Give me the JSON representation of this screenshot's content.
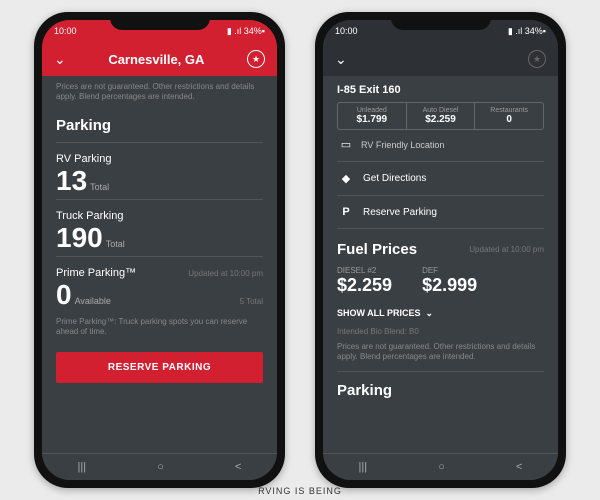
{
  "status": {
    "time": "10:00",
    "battery": "34%"
  },
  "left": {
    "title": "Carnesville, GA",
    "disclaimer": "Prices are not guaranteed. Other restrictions and details apply. Blend percentages are intended.",
    "section": "Parking",
    "rv_label": "RV Parking",
    "rv_count": "13",
    "total": "Total",
    "truck_label": "Truck Parking",
    "truck_count": "190",
    "prime_label": "Prime Parking™",
    "prime_updated": "Updated at 10:00 pm",
    "prime_count": "0",
    "available": "Available",
    "prime_total": "5 Total",
    "prime_desc": "Prime Parking™: Truck parking spots you can reserve ahead of time.",
    "reserve_btn": "RESERVE PARKING"
  },
  "right": {
    "exit": "I-85 Exit 160",
    "tabs": [
      {
        "label": "Unleaded",
        "val": "$1.799"
      },
      {
        "label": "Auto Diesel",
        "val": "$2.259"
      },
      {
        "label": "Restaurants",
        "val": "0"
      }
    ],
    "rv_friendly": "RV Friendly Location",
    "directions": "Get Directions",
    "reserve": "Reserve Parking",
    "fuel_title": "Fuel Prices",
    "fuel_updated": "Updated at 10:00 pm",
    "diesel_label": "DIESEL #2",
    "diesel_price": "$2.259",
    "def_label": "DEF",
    "def_price": "$2.999",
    "show_all": "SHOW ALL PRICES",
    "blend": "Intended Bio Blend: B0",
    "disclaimer": "Prices are not guaranteed. Other restrictions and details apply. Blend percentages are intended.",
    "parking": "Parking"
  },
  "caption": "RVING IS BEING"
}
